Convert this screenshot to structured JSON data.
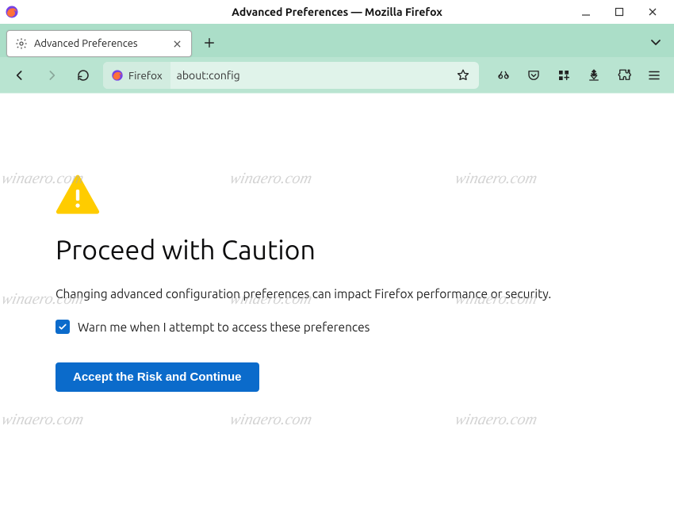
{
  "window": {
    "title": "Advanced Preferences — Mozilla Firefox"
  },
  "tab": {
    "label": "Advanced Preferences"
  },
  "urlbar": {
    "chip_label": "Firefox",
    "url": "about:config"
  },
  "page": {
    "heading": "Proceed with Caution",
    "description": "Changing advanced configuration preferences can impact Firefox performance or security.",
    "checkbox_label": "Warn me when I attempt to access these preferences",
    "checkbox_checked": true,
    "button_label": "Accept the Risk and Continue"
  },
  "watermark": "winaero.com",
  "icons": {
    "gear": "gear",
    "plus": "plus",
    "chevron_down": "chevron-down",
    "back": "arrow-left",
    "forward": "arrow-right",
    "reload": "reload",
    "star": "star",
    "scissors": "scissors",
    "pocket": "pocket",
    "addons": "addons",
    "downloads": "downloads",
    "extensions": "puzzle",
    "menu": "hamburger",
    "minimize": "minimize",
    "maximize": "maximize",
    "close": "close",
    "firefox": "firefox",
    "warning": "warning-triangle"
  },
  "colors": {
    "accent": "#0b6bcb",
    "tabstrip_bg": "#abdec8",
    "navbar_bg": "#b9e4d1",
    "urlbar_bg": "#e0f3ea",
    "warning_yellow": "#ffcc00"
  }
}
